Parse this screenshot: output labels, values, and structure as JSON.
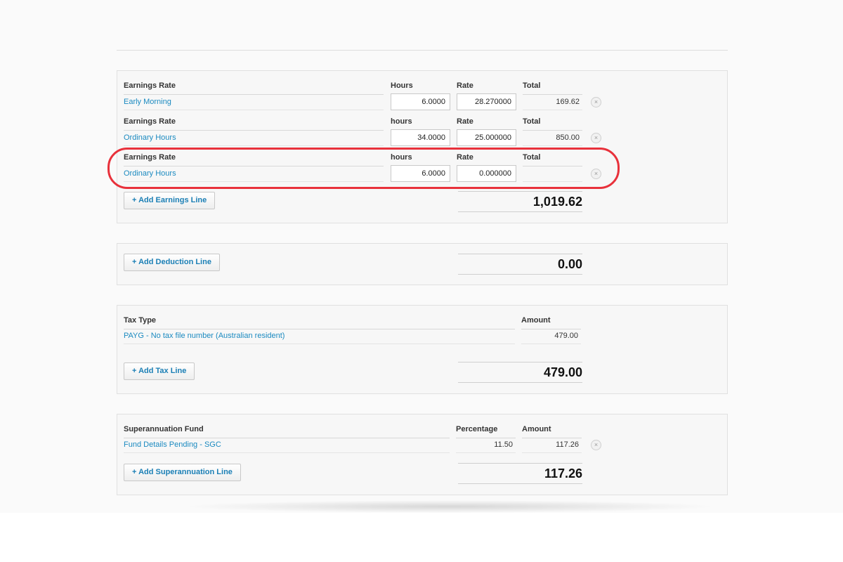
{
  "earnings": {
    "rows": [
      {
        "col_rate": "Earnings Rate",
        "col_hours": "Hours",
        "col_rate2": "Rate",
        "col_total": "Total",
        "name": "Early Morning",
        "hours": "6.0000",
        "rate": "28.270000",
        "total": "169.62"
      },
      {
        "col_rate": "Earnings Rate",
        "col_hours": "hours",
        "col_rate2": "Rate",
        "col_total": "Total",
        "name": "Ordinary Hours",
        "hours": "34.0000",
        "rate": "25.000000",
        "total": "850.00"
      },
      {
        "col_rate": "Earnings Rate",
        "col_hours": "hours",
        "col_rate2": "Rate",
        "col_total": "Total",
        "name": "Ordinary Hours",
        "hours": "6.0000",
        "rate": "0.000000",
        "total": ""
      }
    ],
    "add_label": "+ Add Earnings Line",
    "total": "1,019.62"
  },
  "deductions": {
    "add_label": "+ Add Deduction Line",
    "total": "0.00"
  },
  "tax": {
    "col_type": "Tax Type",
    "col_amount": "Amount",
    "row": {
      "name": "PAYG - No tax file number (Australian resident)",
      "amount": "479.00"
    },
    "add_label": "+ Add Tax Line",
    "total": "479.00"
  },
  "super": {
    "col_fund": "Superannuation Fund",
    "col_pct": "Percentage",
    "col_amount": "Amount",
    "row": {
      "name": "Fund Details Pending - SGC",
      "percentage": "11.50",
      "amount": "117.26"
    },
    "add_label": "+ Add Superannuation Line",
    "total": "117.26"
  },
  "icons": {
    "remove": "×"
  },
  "colors": {
    "link": "#1b8ac0",
    "highlight": "#e8313b"
  }
}
